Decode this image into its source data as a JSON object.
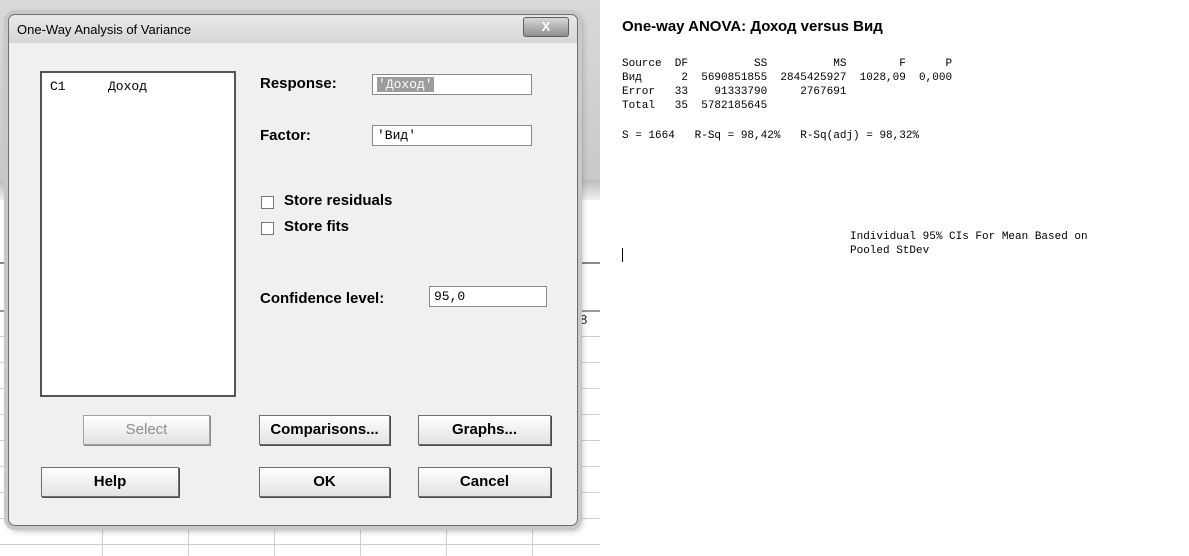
{
  "dialog": {
    "title": "One-Way Analysis of Variance",
    "close_label": "X",
    "variables": [
      {
        "column": "C1",
        "name": "Доход"
      }
    ],
    "response": {
      "label": "Response:",
      "value": "'Доход'"
    },
    "factor": {
      "label": "Factor:",
      "value": "'Вид'"
    },
    "store_residuals": {
      "label": "Store residuals",
      "checked": false
    },
    "store_fits": {
      "label": "Store fits",
      "checked": false
    },
    "confidence": {
      "label": "Confidence level:",
      "value": "95,0"
    },
    "buttons": {
      "select": "Select",
      "comparisons": "Comparisons...",
      "graphs": "Graphs...",
      "help": "Help",
      "ok": "OK",
      "cancel": "Cancel"
    }
  },
  "background": {
    "cell_fragment": "8"
  },
  "session": {
    "title": "One-way ANOVA: Доход versus Вид",
    "table": {
      "header": "Source  DF          SS          MS        F      P",
      "rows": [
        "Вид      2  5690851855  2845425927  1028,09  0,000",
        "Error   33    91333790     2767691",
        "Total   35  5782185645"
      ]
    },
    "stats": "S = 1664   R-Sq = 98,42%   R-Sq(adj) = 98,32%",
    "ci_line1": "Individual 95% CIs For Mean Based on",
    "ci_line2": "Pooled StDev"
  }
}
